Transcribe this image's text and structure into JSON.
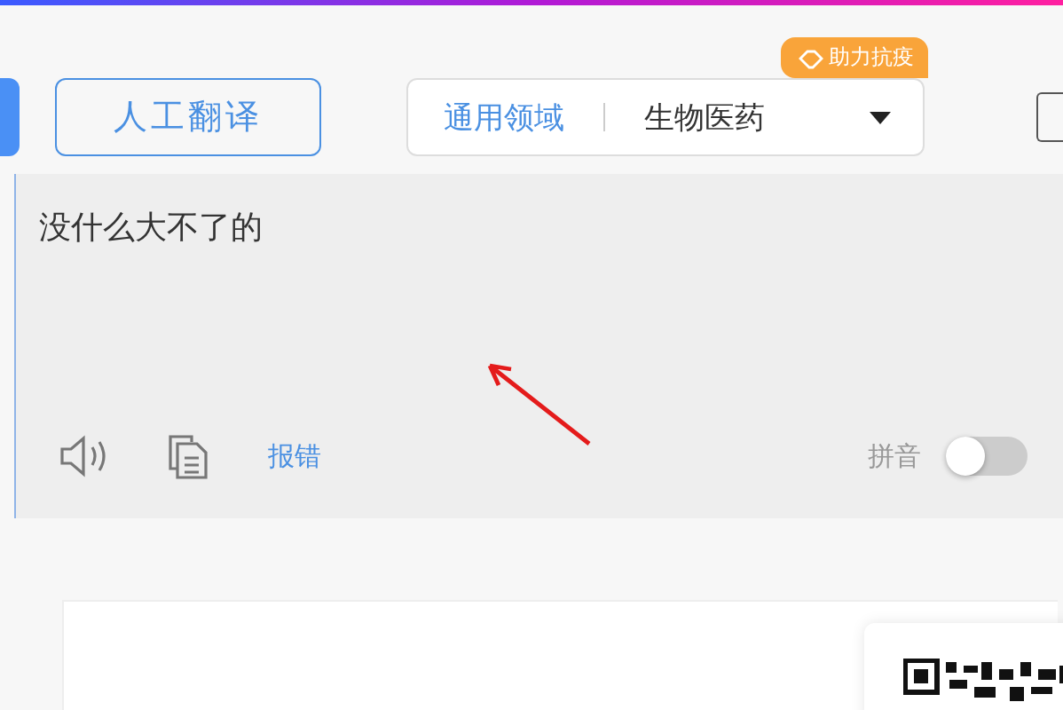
{
  "human_translation_button": "人工翻译",
  "domain": {
    "badge": "助力抗疫",
    "general": "通用领域",
    "value": "生物医药"
  },
  "source": {
    "text": "没什么大不了的",
    "report": "报错",
    "pinyin": {
      "label": "拼音",
      "on": false
    }
  }
}
